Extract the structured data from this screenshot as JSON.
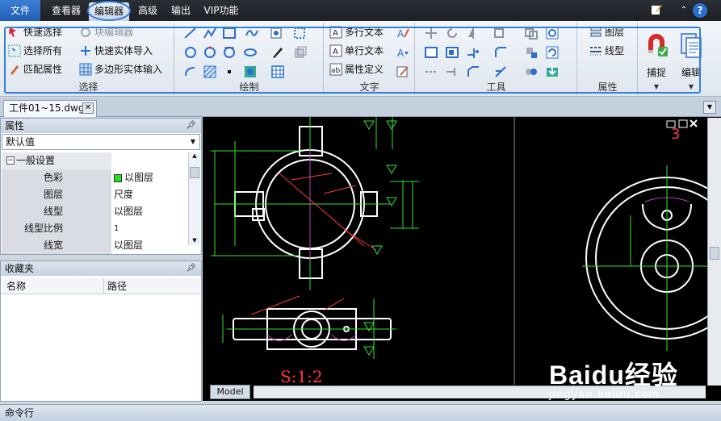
{
  "menu": {
    "tabs": [
      {
        "label": "文件"
      },
      {
        "label": "查看器"
      },
      {
        "label": "编辑器"
      },
      {
        "label": "高级"
      },
      {
        "label": "输出"
      },
      {
        "label": "VIP功能"
      }
    ],
    "active_tab": "编辑器"
  },
  "ribbon": {
    "select": {
      "label": "选择",
      "quick_select": "快速选择",
      "block_editor": "块编辑器",
      "select_all": "选择所有",
      "quick_solid_import": "快速实体导入",
      "match_props": "匹配属性",
      "polygon_solid_input": "多边形实体输入"
    },
    "draw": {
      "label": "绘制"
    },
    "text": {
      "label": "文字",
      "mtext": "多行文本",
      "stext": "单行文本",
      "attdef": "属性定义"
    },
    "tools": {
      "label": "工具"
    },
    "props": {
      "label": "属性",
      "layer": "图层",
      "linetype": "线型"
    },
    "snap": "捕捉",
    "edit": "编辑"
  },
  "doc_tab": {
    "label": "工件01~15.dwg"
  },
  "properties_panel": {
    "title": "属性",
    "combo_value": "默认值",
    "section": "一般设置",
    "rows": [
      {
        "key": "色彩",
        "value": "以图层"
      },
      {
        "key": "图层",
        "value": "尺度"
      },
      {
        "key": "线型",
        "value": "以图层"
      },
      {
        "key": "线型比例",
        "value": "1"
      },
      {
        "key": "线宽",
        "value": "以图层"
      }
    ]
  },
  "favorites_panel": {
    "title": "收藏夹",
    "col_name": "名称",
    "col_path": "路径"
  },
  "drawing": {
    "scale_text": "S:1:2",
    "sheet_number": "3",
    "model_tab": "Model"
  },
  "command_line": {
    "label": "命令行"
  },
  "watermark": {
    "brand": "Baidu经验",
    "url": "jingyan.baidu.com"
  },
  "colors": {
    "accent": "#2f7fe0",
    "canvas": "#000000",
    "drawing_white": "#ffffff",
    "dim_green": "#2ee62e",
    "dim_red": "#ff3a3a",
    "center_magenta": "#c040c0"
  }
}
